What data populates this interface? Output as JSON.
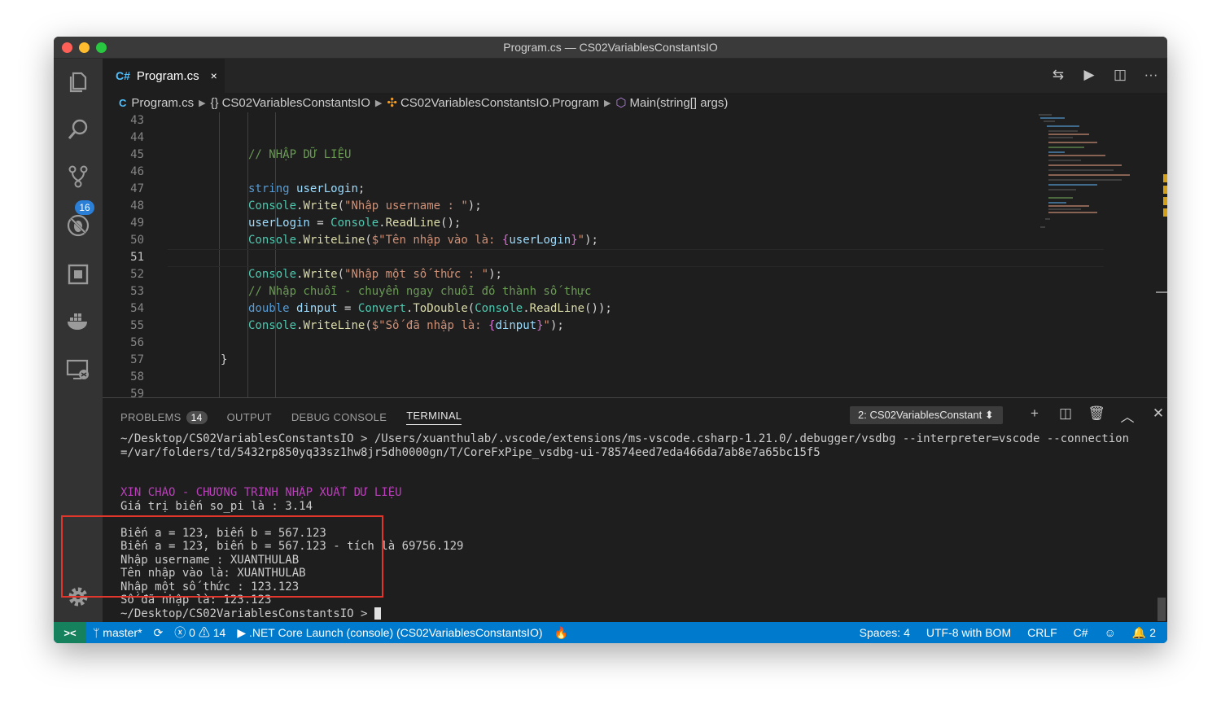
{
  "window": {
    "title": "Program.cs — CS02VariablesConstantsIO"
  },
  "activity": {
    "items": [
      {
        "name": "explorer-icon"
      },
      {
        "name": "search-icon"
      },
      {
        "name": "source-control-icon",
        "badge": "16"
      },
      {
        "name": "debug-icon"
      },
      {
        "name": "extensions-icon"
      },
      {
        "name": "docker-icon"
      },
      {
        "name": "remote-explorer-icon"
      }
    ],
    "settings_icon": "gear-icon"
  },
  "tab": {
    "icon": "C#",
    "label": "Program.cs",
    "close": "×"
  },
  "editor_actions": [
    "⇆",
    "▶",
    "◫",
    "···"
  ],
  "breadcrumb": {
    "file": "Program.cs",
    "namespace": "CS02VariablesConstantsIO",
    "class": "CS02VariablesConstantsIO.Program",
    "method": "Main(string[] args)"
  },
  "code": {
    "active_line": "51",
    "lines": [
      {
        "n": "43"
      },
      {
        "n": "44"
      },
      {
        "n": "45"
      },
      {
        "n": "46"
      },
      {
        "n": "47"
      },
      {
        "n": "48"
      },
      {
        "n": "49"
      },
      {
        "n": "50"
      },
      {
        "n": "51"
      },
      {
        "n": "52"
      },
      {
        "n": "53"
      },
      {
        "n": "54"
      },
      {
        "n": "55"
      },
      {
        "n": "56"
      },
      {
        "n": "57"
      },
      {
        "n": "58"
      },
      {
        "n": "59"
      }
    ]
  },
  "panel": {
    "tabs": {
      "problems": "PROBLEMS",
      "problems_count": "14",
      "output": "OUTPUT",
      "debug": "DEBUG CONSOLE",
      "terminal": "TERMINAL"
    },
    "terminal_select": "2: CS02VariablesConstant ⬍",
    "actions": [
      "+",
      "◫",
      "🗑",
      "︿",
      "✕"
    ]
  },
  "terminal": {
    "lines": [
      "~/Desktop/CS02VariablesConstantsIO > /Users/xuanthulab/.vscode/extensions/ms-vscode.csharp-1.21.0/.debugger/vsdbg --interpreter=vscode --connection",
      "=/var/folders/td/5432rp850yq33sz1hw8jr5dh0000gn/T/CoreFxPipe_vsdbg-ui-78574eed7eda466da7ab8e7a65bc15f5",
      "",
      "",
      "XIN CHÀO - CHƯƠNG TRÌNH NHẬP XUẤT DỮ LIỆU",
      "Giá trị biến so_pi là : 3.14",
      "",
      "Biến a = 123, biến b = 567.123",
      "Biến a = 123, biến b = 567.123 - tích là 69756.129",
      "Nhập username : XUANTHULAB",
      "Tên nhập vào là: XUANTHULAB",
      "Nhập một số thức : 123.123",
      "Số đã nhập là: 123.123",
      "~/Desktop/CS02VariablesConstantsIO > "
    ]
  },
  "status": {
    "remote": "><",
    "branch": "master*",
    "sync": "⟳",
    "errors": "0",
    "warnings": "14",
    "launch": ".NET Core Launch (console) (CS02VariablesConstantsIO)",
    "flame": "🔥",
    "spaces": "Spaces: 4",
    "encoding": "UTF-8 with BOM",
    "eol": "CRLF",
    "language": "C#",
    "feedback": "☺",
    "notifications": "2"
  }
}
